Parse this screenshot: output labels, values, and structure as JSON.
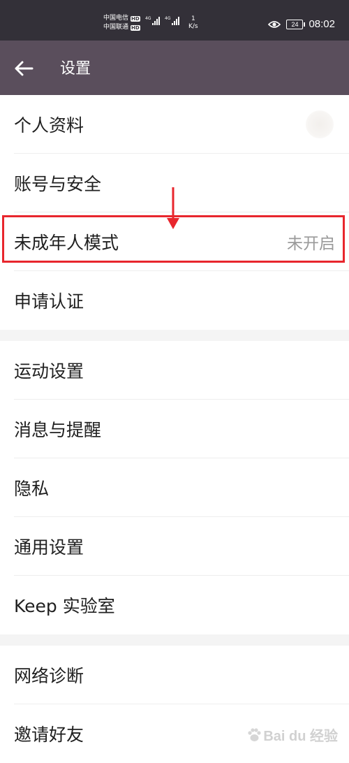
{
  "status_bar": {
    "carrier_1": "中国电信",
    "carrier_2": "中国联通",
    "hd": "HD",
    "net_1": "4G",
    "net_2": "4G",
    "speed_value": "1",
    "speed_unit": "K/s",
    "battery": "24",
    "time": "08:02"
  },
  "header": {
    "title": "设置",
    "back_icon": "arrow-left-icon"
  },
  "sections": [
    {
      "items": [
        {
          "label": "个人资料",
          "value": "",
          "accessory": "avatar"
        },
        {
          "label": "账号与安全",
          "value": ""
        },
        {
          "label": "未成年人模式",
          "value": "未开启"
        },
        {
          "label": "申请认证",
          "value": ""
        }
      ]
    },
    {
      "items": [
        {
          "label": "运动设置",
          "value": ""
        },
        {
          "label": "消息与提醒",
          "value": ""
        },
        {
          "label": "隐私",
          "value": ""
        },
        {
          "label": "通用设置",
          "value": ""
        },
        {
          "label": "Keep 实验室",
          "value": ""
        }
      ]
    },
    {
      "items": [
        {
          "label": "网络诊断",
          "value": ""
        },
        {
          "label": "邀请好友",
          "value": ""
        }
      ]
    }
  ],
  "annotation": {
    "color": "#e8262d"
  },
  "watermark": {
    "text": "Bai du 经验"
  },
  "colors": {
    "status_bar_bg": "#333038",
    "header_bg": "#5a4e5c",
    "accent_red": "#e8262d"
  }
}
